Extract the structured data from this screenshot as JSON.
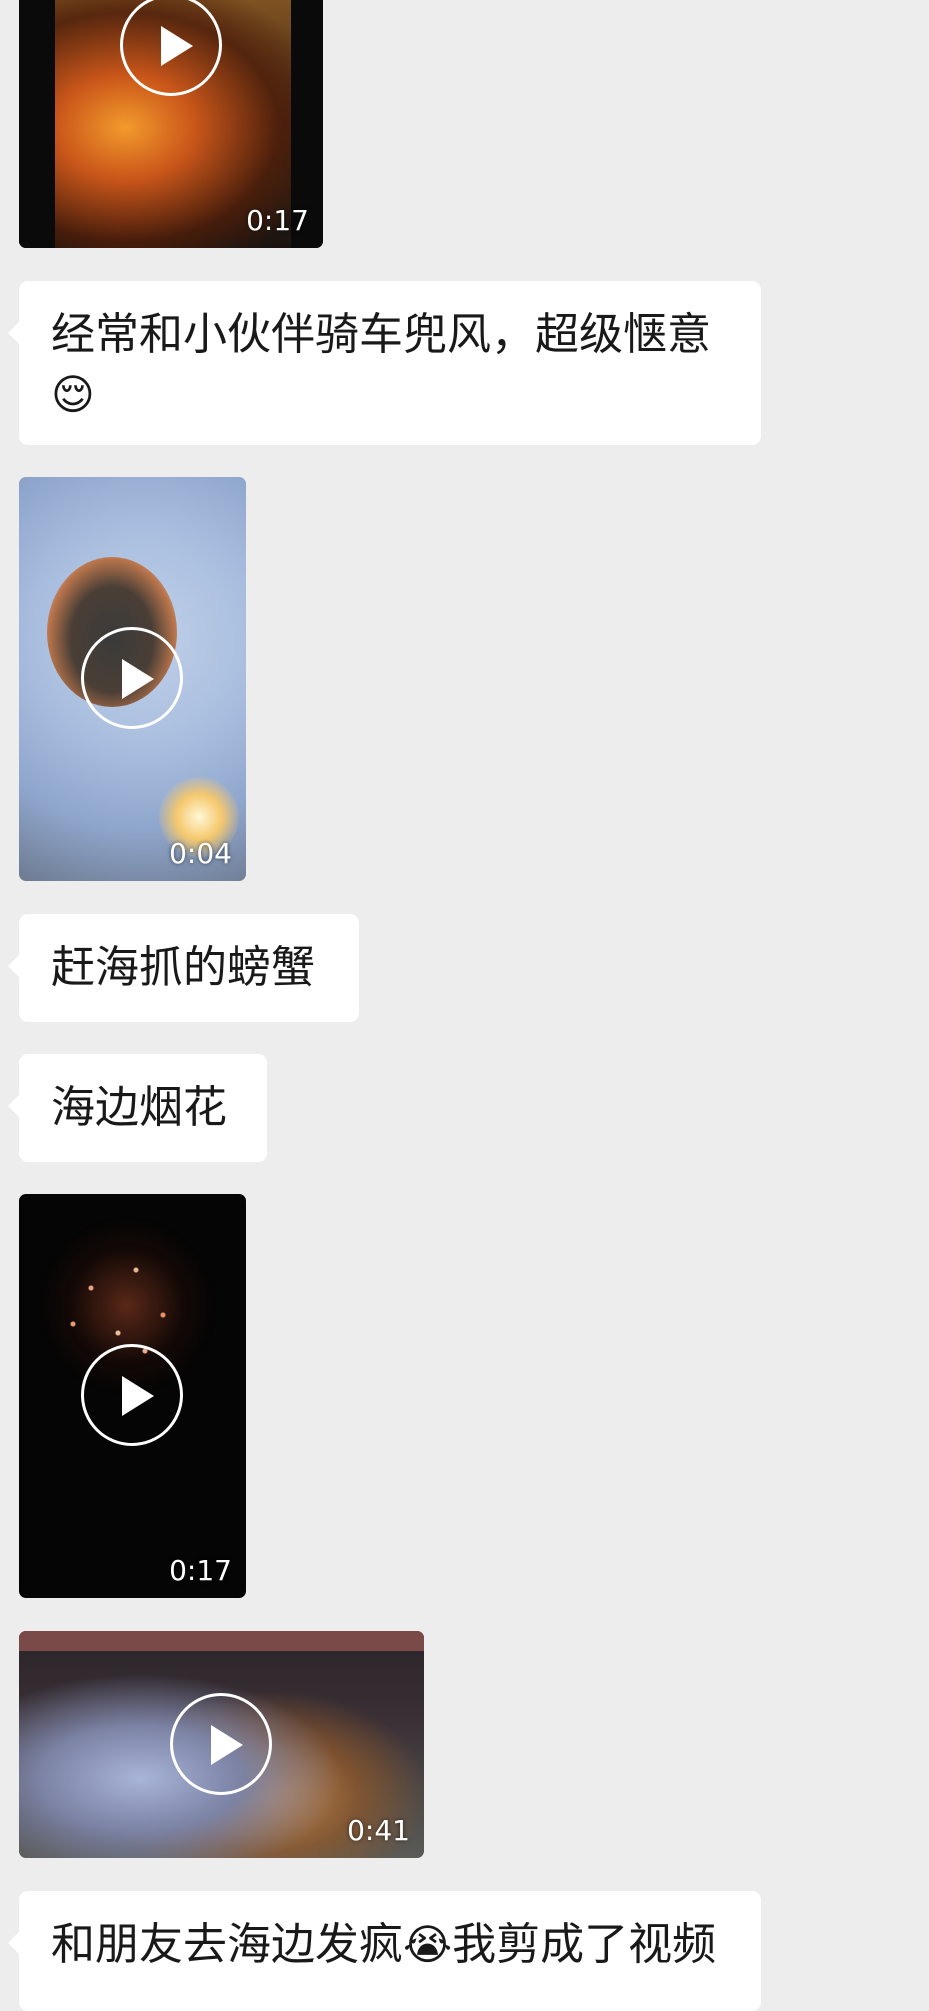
{
  "messages": [
    {
      "type": "video",
      "duration": "0:17"
    },
    {
      "type": "text",
      "text": "经常和小伙伴骑车兜风，超级惬意",
      "emoji": "😌",
      "emoji_name": "relieved-face-emoji"
    },
    {
      "type": "video",
      "duration": "0:04"
    },
    {
      "type": "text",
      "text": "赶海抓的螃蟹"
    },
    {
      "type": "text",
      "text": "海边烟花"
    },
    {
      "type": "video",
      "duration": "0:17"
    },
    {
      "type": "video",
      "duration": "0:41"
    },
    {
      "type": "text",
      "text_before": "和朋友去海边发疯",
      "emoji": "😭",
      "emoji_name": "loudly-crying-face-emoji",
      "text_after": "我剪成了视频"
    }
  ],
  "colors": {
    "background": "#ededed",
    "bubble": "#ffffff",
    "text": "#191919"
  },
  "icons": {
    "play": "play-icon"
  }
}
